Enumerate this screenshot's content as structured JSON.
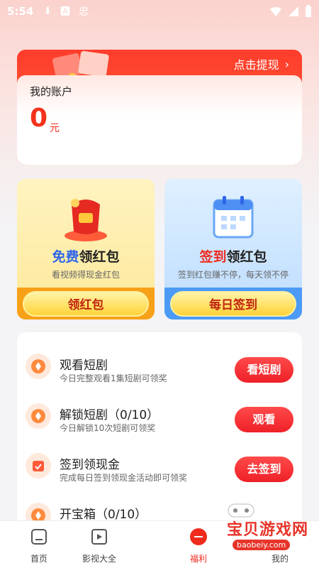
{
  "status_bar": {
    "time": "5:54",
    "icons": [
      "download-icon",
      "a-icon",
      "app-icon"
    ],
    "right_icons": [
      "wifi-icon",
      "signal-icon",
      "battery-icon"
    ]
  },
  "account": {
    "withdraw_label": "点击提现",
    "title": "我的账户",
    "amount": "0",
    "unit": "元"
  },
  "promos": [
    {
      "title_highlight": "免费",
      "title_rest": "领红包",
      "subtitle": "看视频得现金红包",
      "button": "领红包",
      "icon": "red-envelope-icon"
    },
    {
      "title_highlight": "签到",
      "title_rest": "领红包",
      "subtitle": "签到红包赚不停，每天领不停",
      "button": "每日签到",
      "icon": "calendar-icon"
    }
  ],
  "tasks": [
    {
      "title": "观看短剧",
      "desc": "今日完整观看1集短剧可领奖",
      "button": "看短剧",
      "icon": "coin-icon"
    },
    {
      "title": "解锁短剧（0/10）",
      "desc": "今日解锁10次短剧可领奖",
      "button": "观看",
      "icon": "coin-icon"
    },
    {
      "title": "签到领现金",
      "desc": "完成每日签到领现金活动即可领奖",
      "button": "去签到",
      "icon": "checkin-icon"
    },
    {
      "title": "开宝箱（0/10）",
      "desc": "",
      "button": "",
      "icon": "coin-icon"
    }
  ],
  "nav": [
    {
      "label": "首页",
      "icon": "home-icon"
    },
    {
      "label": "影视大全",
      "icon": "video-icon"
    },
    {
      "label": "福利",
      "icon": "welfare-icon"
    },
    {
      "label": "",
      "icon": "hidden-icon"
    },
    {
      "label": "我的",
      "icon": "profile-icon"
    }
  ],
  "watermark": {
    "text": "宝贝游戏网",
    "url": "baobeiy.com"
  },
  "colors": {
    "accent": "#ef2b1e",
    "blue": "#2f65e8",
    "gold": "#ffd338"
  }
}
